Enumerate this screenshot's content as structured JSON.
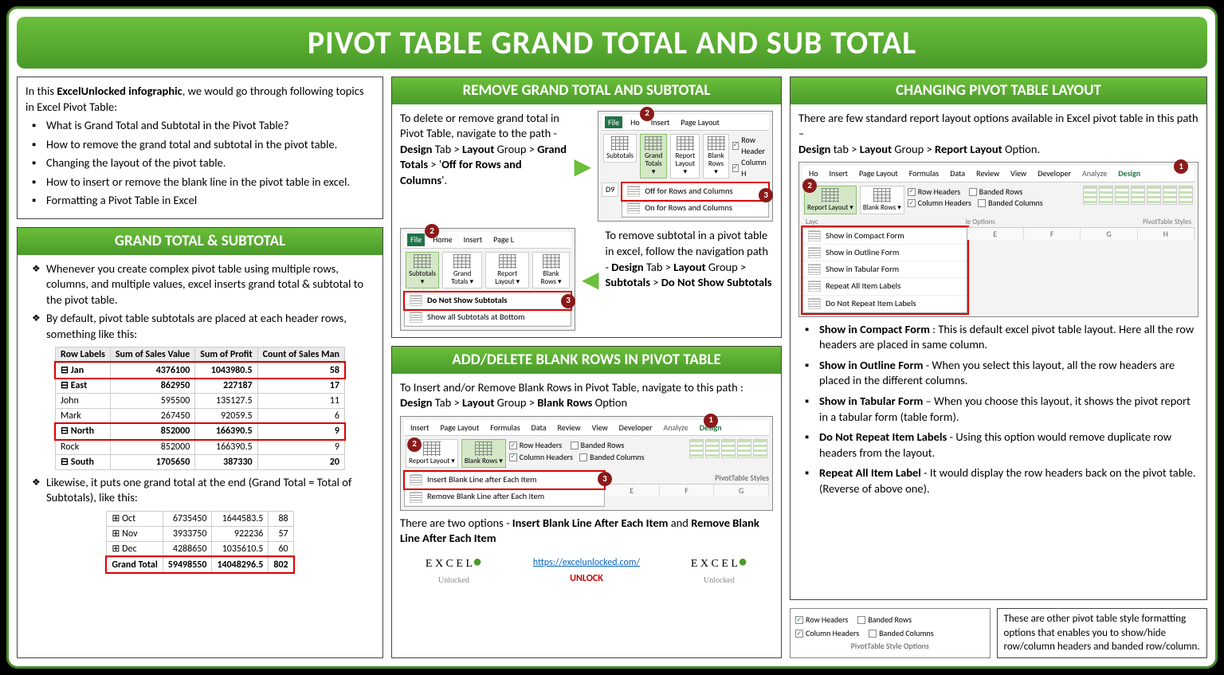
{
  "title": "PIVOT TABLE GRAND TOTAL AND SUB TOTAL",
  "intro": {
    "lead_html": "In this <b>ExcelUnlocked infographic</b>, we would go through following topics in Excel Pivot Table:",
    "bullets": [
      "What is Grand Total and Subtotal in the Pivot Table?",
      "How to remove the grand total and subtotal in the pivot table.",
      "Changing the layout of the pivot table.",
      "How to insert or remove the blank line in the pivot table in excel.",
      "Formatting a Pivot Table in Excel"
    ]
  },
  "section_gt": {
    "head": "GRAND TOTAL & SUBTOTAL",
    "p1": "Whenever you create complex pivot table using multiple rows, columns, and multiple values, excel inserts grand total & subtotal to the pivot table.",
    "p2": "By default, pivot table subtotals are placed at each header rows, something like this:",
    "table1": {
      "headers": [
        "Row Labels",
        "Sum of Sales Value",
        "Sum of Profit",
        "Count of Sales Man"
      ],
      "rows": [
        {
          "label": "⊟ Jan",
          "v": [
            "4376100",
            "1043980.5",
            "58"
          ],
          "sub": true,
          "red": true
        },
        {
          "label": "⊟ East",
          "v": [
            "862950",
            "227187",
            "17"
          ],
          "sub": true
        },
        {
          "label": "  John",
          "v": [
            "595500",
            "135127.5",
            "11"
          ]
        },
        {
          "label": "  Mark",
          "v": [
            "267450",
            "92059.5",
            "6"
          ]
        },
        {
          "label": "⊟ North",
          "v": [
            "852000",
            "166390.5",
            "9"
          ],
          "sub": true,
          "red": true
        },
        {
          "label": "  Rock",
          "v": [
            "852000",
            "166390.5",
            "9"
          ]
        },
        {
          "label": "⊟ South",
          "v": [
            "1705650",
            "387330",
            "20"
          ],
          "sub": true
        }
      ]
    },
    "p3": "Likewise, it puts one grand total at the end (Grand Total = Total of Subtotals), like this:",
    "table2": {
      "rows": [
        {
          "label": "⊞ Oct",
          "v": [
            "6735450",
            "1644583.5",
            "88"
          ]
        },
        {
          "label": "⊞ Nov",
          "v": [
            "3933750",
            "922236",
            "57"
          ]
        },
        {
          "label": "⊞ Dec",
          "v": [
            "4288650",
            "1035610.5",
            "60"
          ]
        },
        {
          "label": "Grand Total",
          "v": [
            "59498550",
            "14048296.5",
            "802"
          ],
          "sub": true,
          "red": true
        }
      ]
    }
  },
  "section_remove": {
    "head": "REMOVE GRAND TOTAL AND SUBTOTAL",
    "p1_html": "To delete or remove grand total in Pivot Table, navigate to the path - <b>Design</b> Tab > <b>Layout</b> Group > <b>Grand Totals</b> > '<b>Off for Rows and Columns</b>'.",
    "ribbon1": {
      "tabs": [
        "File",
        "Ho",
        "Insert",
        "Page Layout"
      ],
      "buttons": [
        "Subtotals",
        "Grand Totals ▾",
        "Report Layout ▾",
        "Blank Rows ▾"
      ],
      "checks": [
        "Row Header",
        "Column H"
      ],
      "menu": [
        "Off for Rows and Columns",
        "On for Rows and Columns"
      ],
      "cell": "D9"
    },
    "p2_html": "To remove subtotal in a pivot table in excel, follow the navigation path - <b>Design</b> Tab > <b>Layout</b> Group > <b>Subtotals</b> > <b>Do Not Show Subtotals</b>",
    "ribbon2": {
      "tabs": [
        "File",
        "Home",
        "Insert",
        "Page L"
      ],
      "buttons": [
        "Subtotals ▾",
        "Grand Totals ▾",
        "Report Layout ▾",
        "Blank Rows ▾"
      ],
      "menu": [
        "Do Not Show Subtotals",
        "Show all Subtotals at Bottom"
      ]
    }
  },
  "section_blank": {
    "head": "ADD/DELETE BLANK ROWS IN PIVOT TABLE",
    "p1_html": "To Insert and/or Remove Blank Rows in Pivot Table, navigate to this path :<br><b>Design</b> Tab > <b>Layout</b> Group > <b>Blank Rows</b> Option",
    "ribbon": {
      "tabs": [
        "Insert",
        "Page Layout",
        "Formulas",
        "Data",
        "Review",
        "View",
        "Developer",
        "Analyze",
        "Design"
      ],
      "buttons": [
        "Report Layout ▾",
        "Blank Rows ▾"
      ],
      "checks": [
        "Row Headers",
        "Banded Rows",
        "Column Headers",
        "Banded Columns"
      ],
      "menu": [
        "Insert Blank Line after Each Item",
        "Remove Blank Line after Each Item"
      ],
      "grid": [
        "E",
        "F",
        "G"
      ],
      "styles_label": "PivotTable Styles"
    },
    "p2_html": "There are two options - <b>Insert Blank Line After Each Item</b> and <b>Remove Blank Line After Each Item</b>"
  },
  "section_layout": {
    "head": "CHANGING PIVOT TABLE LAYOUT",
    "p1_html": "There are few standard report layout options available in Excel pivot table in this path –<br><b>Design</b> tab > <b>Layout</b> Group > <b>Report Layout</b> Option.",
    "ribbon": {
      "tabs": [
        "Ho",
        "Insert",
        "Page Layout",
        "Formulas",
        "Data",
        "Review",
        "View",
        "Developer",
        "Analyze",
        "Design"
      ],
      "buttons": [
        "Report Layout ▾",
        "Blank Rows ▾"
      ],
      "checks": [
        "Row Headers",
        "Banded Rows",
        "Column Headers",
        "Banded Columns"
      ],
      "menu": [
        "Show in Compact Form",
        "Show in Outline Form",
        "Show in Tabular Form",
        "Repeat All Item Labels",
        "Do Not Repeat Item Labels"
      ],
      "grid": [
        "E",
        "F",
        "G",
        "H"
      ],
      "groups": [
        "Layc",
        "le Options",
        "PivotTable Styles"
      ]
    },
    "bullets_html": [
      "<b>Show in Compact Form</b> : This is default excel pivot table layout. Here all the row headers are placed in same column.",
      "<b>Show in Outline Form</b> - When you select this layout, all the row headers are placed in the different columns.",
      "<b>Show in Tabular Form</b> – When you choose this layout, it shows the pivot report in a tabular form (table form).",
      "<b>Do Not Repeat Item Labels</b> - Using this option would remove duplicate row headers from the layout.",
      "<b>Repeat All Item Label</b> - It would display the row headers back on the pivot table. (Reverse of above one)."
    ]
  },
  "style_opts": {
    "checks": [
      "Row Headers",
      "Banded Rows",
      "Column Headers",
      "Banded Columns"
    ],
    "label": "PivotTable Style Options",
    "desc": "These are other pivot table style formatting options that enables you to show/hide row/column headers and banded row/column."
  },
  "footer": {
    "logo_text": "E X C E L",
    "logo_sub": "Unlocked",
    "url": "https://excelunlocked.com/",
    "unlock": "UNLOCK"
  }
}
